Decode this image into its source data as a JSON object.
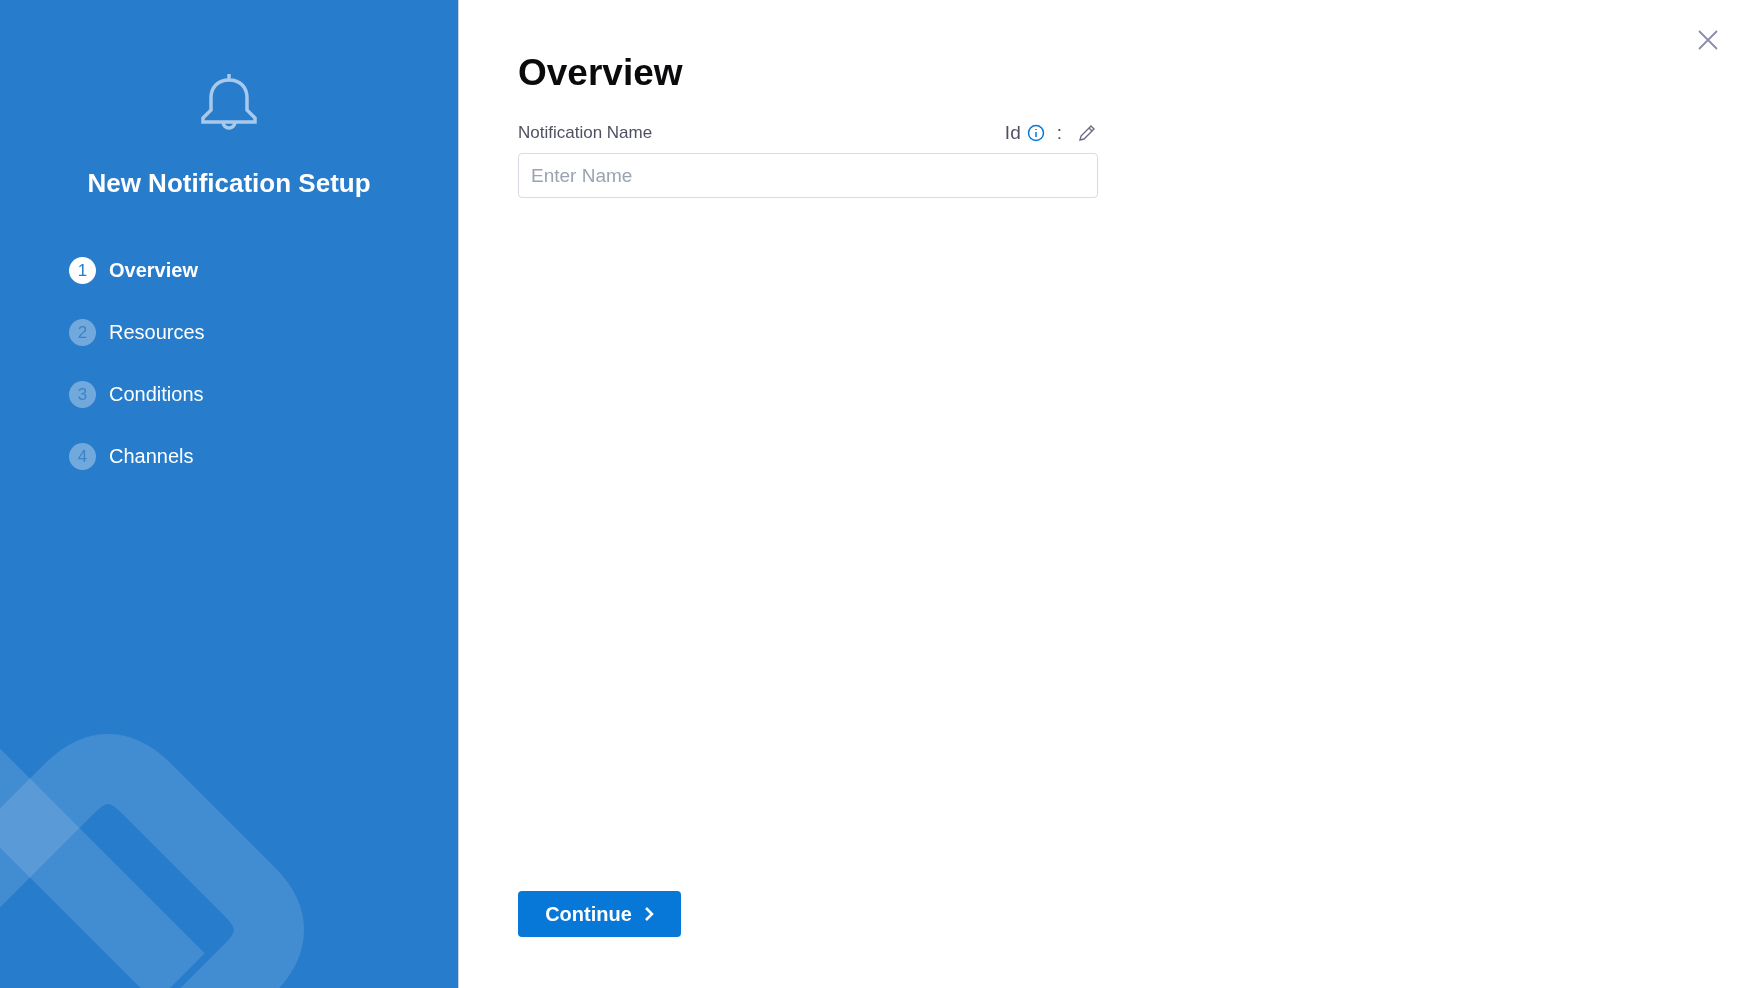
{
  "sidebar": {
    "title": "New Notification Setup",
    "steps": [
      {
        "number": "1",
        "label": "Overview",
        "selected": true
      },
      {
        "number": "2",
        "label": "Resources",
        "selected": false
      },
      {
        "number": "3",
        "label": "Conditions",
        "selected": false
      },
      {
        "number": "4",
        "label": "Channels",
        "selected": false
      }
    ]
  },
  "main": {
    "heading": "Overview",
    "field": {
      "label": "Notification Name",
      "id_label": "Id",
      "separator": ":",
      "placeholder": "Enter Name"
    },
    "continue_button": "Continue"
  }
}
